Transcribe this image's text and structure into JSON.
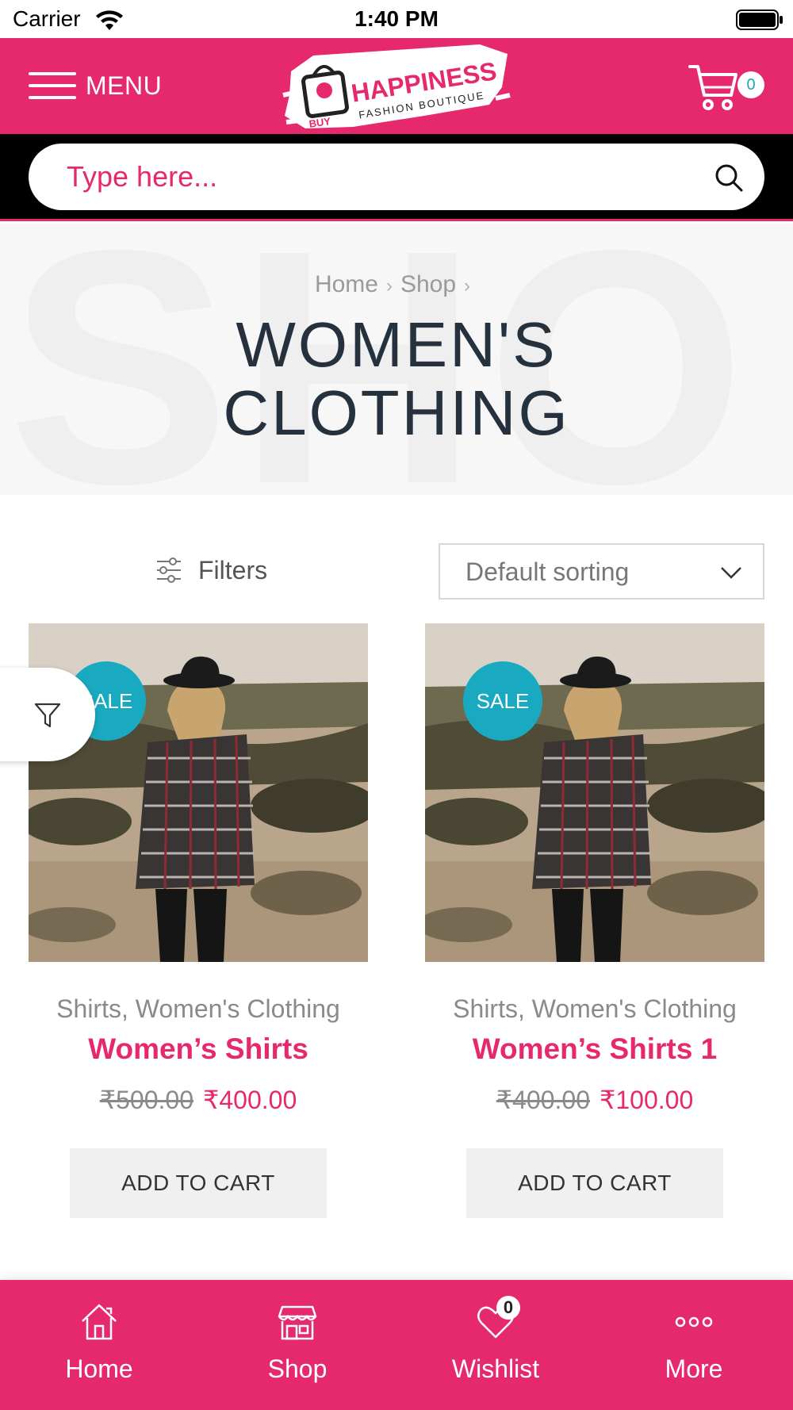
{
  "status_bar": {
    "carrier": "Carrier",
    "time": "1:40 PM"
  },
  "header": {
    "menu_label": "MENU",
    "cart_count": "0",
    "logo_text": "HAPPINESS",
    "logo_sub": "FASHION BOUTIQUE",
    "logo_bag": "BUY"
  },
  "search": {
    "placeholder": "Type here..."
  },
  "hero": {
    "breadcrumb": [
      "Home",
      "Shop"
    ],
    "title_line1": "WOMEN'S",
    "title_line2": "CLOTHING",
    "bg_text": "SHO"
  },
  "toolbar": {
    "filters_label": "Filters",
    "sort_label": "Default sorting"
  },
  "products": [
    {
      "sale_label": "SALE",
      "categories": "Shirts, Women's Clothing",
      "name": "Women’s Shirts",
      "old_price": "₹500.00",
      "new_price": "₹400.00",
      "button": "ADD TO CART"
    },
    {
      "sale_label": "SALE",
      "categories": "Shirts, Women's Clothing",
      "name": "Women’s Shirts 1",
      "old_price": "₹400.00",
      "new_price": "₹100.00",
      "button": "ADD TO CART"
    }
  ],
  "bottom_nav": {
    "items": [
      {
        "label": "Home",
        "icon": "home-icon"
      },
      {
        "label": "Shop",
        "icon": "store-icon"
      },
      {
        "label": "Wishlist",
        "icon": "heart-icon"
      },
      {
        "label": "More",
        "icon": "more-icon"
      }
    ],
    "wishlist_count": "0"
  },
  "colors": {
    "brand": "#e6296d",
    "sale": "#19aac1",
    "title": "#26313e"
  }
}
